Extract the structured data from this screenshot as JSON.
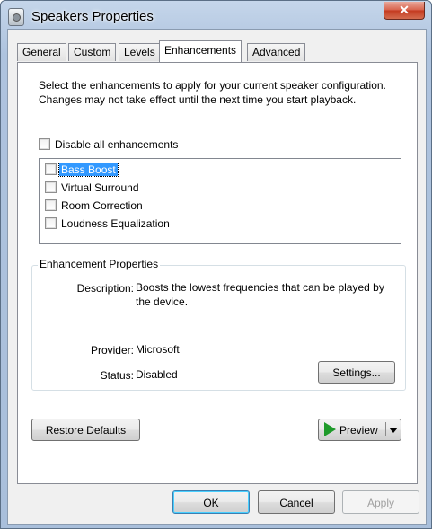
{
  "window": {
    "title": "Speakers Properties",
    "close_label": "✕"
  },
  "tabs": [
    {
      "label": "General"
    },
    {
      "label": "Custom"
    },
    {
      "label": "Levels"
    },
    {
      "label": "Enhancements",
      "active": true
    },
    {
      "label": "Advanced"
    }
  ],
  "enhancements": {
    "intro": "Select the enhancements to apply for your current speaker configuration. Changes may not take effect until the next time you start playback.",
    "disable_all_label": "Disable all enhancements",
    "disable_all_checked": false,
    "items": [
      {
        "label": "Bass Boost",
        "checked": false,
        "selected": true
      },
      {
        "label": "Virtual Surround",
        "checked": false
      },
      {
        "label": "Room Correction",
        "checked": false
      },
      {
        "label": "Loudness Equalization",
        "checked": false
      }
    ]
  },
  "properties": {
    "group_title": "Enhancement Properties",
    "description_label": "Description:",
    "description_value": "Boosts the lowest frequencies that can be played by the device.",
    "provider_label": "Provider:",
    "provider_value": "Microsoft",
    "status_label": "Status:",
    "status_value": "Disabled",
    "settings_button": "Settings..."
  },
  "buttons": {
    "restore_defaults": "Restore Defaults",
    "preview": "Preview",
    "ok": "OK",
    "cancel": "Cancel",
    "apply": "Apply"
  },
  "colors": {
    "selection": "#3399ff",
    "play_icon": "#1e9a2a",
    "close_button": "#c43a20"
  },
  "icons": {
    "window_icon": "speaker-icon",
    "preview_icon": "play-icon",
    "dropdown_icon": "chevron-down-icon"
  }
}
